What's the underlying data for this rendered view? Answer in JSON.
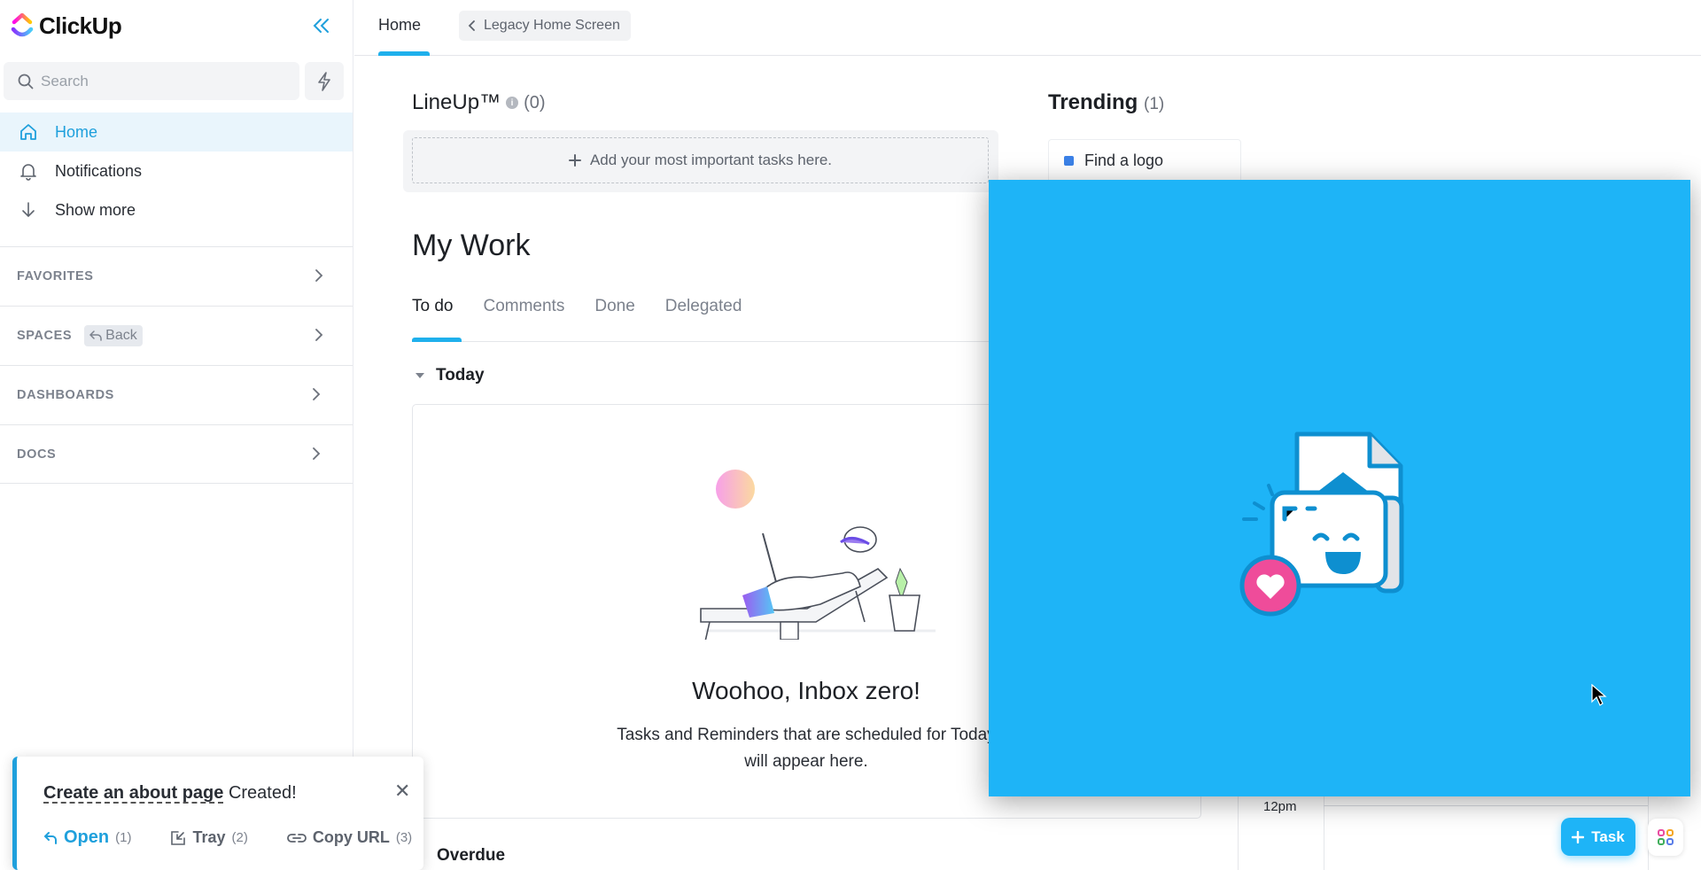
{
  "app": {
    "name": "ClickUp"
  },
  "sidebar": {
    "search_placeholder": "Search",
    "nav": [
      {
        "label": "Home",
        "icon": "home-icon",
        "active": true
      },
      {
        "label": "Notifications",
        "icon": "bell-icon"
      },
      {
        "label": "Show more",
        "icon": "arrow-down-icon"
      }
    ],
    "sections": [
      {
        "label": "FAVORITES"
      },
      {
        "label": "SPACES",
        "chip": "Back"
      },
      {
        "label": "DASHBOARDS"
      },
      {
        "label": "DOCS"
      }
    ]
  },
  "topbar": {
    "tab": "Home",
    "legacy_button": "Legacy Home Screen"
  },
  "lineup": {
    "title": "LineUp™",
    "count": "(0)",
    "add_label": "Add your most important tasks here."
  },
  "trending": {
    "title": "Trending",
    "count": "(1)",
    "items": [
      {
        "label": "Find a logo",
        "color": "#3b82e8"
      }
    ]
  },
  "my_work": {
    "title": "My Work",
    "tabs": [
      {
        "label": "To do",
        "active": true
      },
      {
        "label": "Comments"
      },
      {
        "label": "Done"
      },
      {
        "label": "Delegated"
      }
    ],
    "today_label": "Today",
    "empty_title": "Woohoo, Inbox zero!",
    "empty_subtitle": "Tasks and Reminders that are scheduled for Today will appear here.",
    "overdue_label": "Overdue"
  },
  "calendar": {
    "time_label": "12pm"
  },
  "toast": {
    "link": "Create an about page",
    "suffix": "Created!",
    "actions": [
      {
        "label": "Open",
        "shortcut": "(1)"
      },
      {
        "label": "Tray",
        "shortcut": "(2)"
      },
      {
        "label": "Copy URL",
        "shortcut": "(3)"
      }
    ]
  },
  "fab": {
    "task_label": "Task"
  },
  "colors": {
    "accent": "#1fa0dc",
    "overlay": "#1eb4f7",
    "heart": "#ef4c9a"
  }
}
